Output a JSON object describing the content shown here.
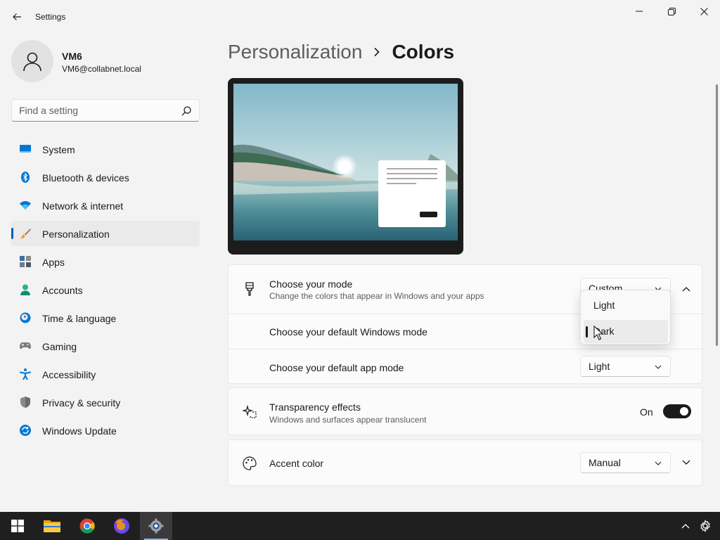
{
  "window": {
    "title": "Settings"
  },
  "user": {
    "name": "VM6",
    "email": "VM6@collabnet.local"
  },
  "search": {
    "placeholder": "Find a setting"
  },
  "nav": [
    {
      "label": "System",
      "icon": "monitor-icon"
    },
    {
      "label": "Bluetooth & devices",
      "icon": "bluetooth-icon"
    },
    {
      "label": "Network & internet",
      "icon": "wifi-icon"
    },
    {
      "label": "Personalization",
      "icon": "paintbrush-icon",
      "active": true
    },
    {
      "label": "Apps",
      "icon": "apps-icon"
    },
    {
      "label": "Accounts",
      "icon": "person-icon"
    },
    {
      "label": "Time & language",
      "icon": "clock-globe-icon"
    },
    {
      "label": "Gaming",
      "icon": "gamepad-icon"
    },
    {
      "label": "Accessibility",
      "icon": "accessibility-icon"
    },
    {
      "label": "Privacy & security",
      "icon": "shield-icon"
    },
    {
      "label": "Windows Update",
      "icon": "sync-icon"
    }
  ],
  "breadcrumb": {
    "parent": "Personalization",
    "current": "Colors"
  },
  "mode": {
    "title": "Choose your mode",
    "subtitle": "Change the colors that appear in Windows and your apps",
    "value": "Custom",
    "menu_options": [
      "Light",
      "Dark"
    ],
    "menu_highlighted": "Dark",
    "windows_mode_label": "Choose your default Windows mode",
    "app_mode_label": "Choose your default app mode",
    "app_mode_value": "Light"
  },
  "transparency": {
    "title": "Transparency effects",
    "subtitle": "Windows and surfaces appear translucent",
    "state": "On",
    "enabled": true
  },
  "accent": {
    "title": "Accent color",
    "value": "Manual"
  },
  "colors": {
    "accent": "#005fb8",
    "toggle_on": "#1a1a1a",
    "taskbar": "#1f1f1f"
  },
  "taskbar": {
    "apps": [
      "start-icon",
      "file-explorer-icon",
      "chrome-icon",
      "firefox-icon",
      "settings-gear-icon"
    ],
    "active_app": "settings-gear-icon"
  }
}
